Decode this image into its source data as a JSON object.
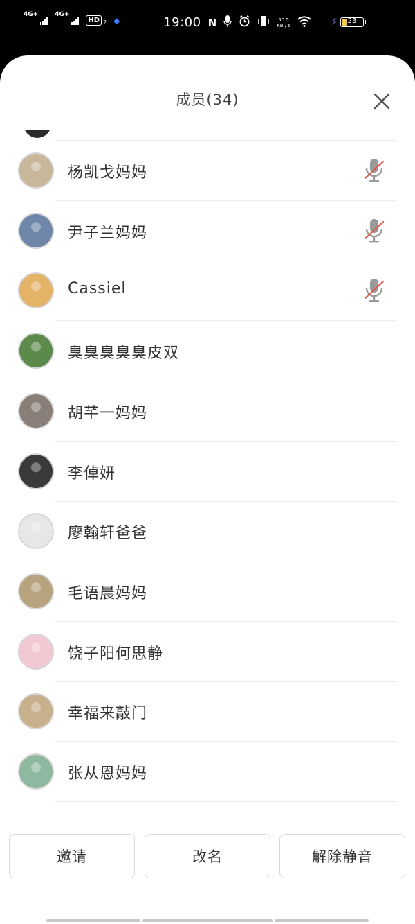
{
  "status_bar": {
    "time": "19:00",
    "signal1_label": "4G+",
    "signal2_label": "4G+",
    "hd_label": "HD",
    "hd_sub": "2",
    "net_speed_value": "50.5",
    "net_speed_unit": "KB / s",
    "battery_level": "23",
    "accent_battery": "#f2c94c",
    "accent_charging": "#a97cff",
    "icons": [
      "nfc-icon",
      "microphone-icon",
      "alarm-icon",
      "vibrate-icon",
      "wifi-icon",
      "charging-icon",
      "battery-icon"
    ]
  },
  "sheet": {
    "title": "成员(34)",
    "close_icon": "close-icon"
  },
  "members": [
    {
      "name": "杨凯戈妈妈",
      "muted": true,
      "avatar_color": "#c9b79c"
    },
    {
      "name": "尹子兰妈妈",
      "muted": true,
      "avatar_color": "#6e86a8"
    },
    {
      "name": "Cassiel",
      "muted": true,
      "avatar_color": "#e3b368"
    },
    {
      "name": "臭臭臭臭臭皮双",
      "muted": false,
      "avatar_color": "#5b8a4a"
    },
    {
      "name": "胡芊一妈妈",
      "muted": false,
      "avatar_color": "#8a7f78"
    },
    {
      "name": "李倬妍",
      "muted": false,
      "avatar_color": "#3a3a3a"
    },
    {
      "name": "廖翰轩爸爸",
      "muted": false,
      "avatar_color": "#e7e7e7"
    },
    {
      "name": "毛语晨妈妈",
      "muted": false,
      "avatar_color": "#b7a37e"
    },
    {
      "name": "饶子阳何思静",
      "muted": false,
      "avatar_color": "#f2c9d2"
    },
    {
      "name": "幸福来敲门",
      "muted": false,
      "avatar_color": "#c7b08c"
    },
    {
      "name": "张从恩妈妈",
      "muted": false,
      "avatar_color": "#8fb8a0"
    }
  ],
  "buttons": {
    "invite": "邀请",
    "rename": "改名",
    "unmute": "解除静音"
  },
  "colors": {
    "mute_slash": "#e05a4a",
    "mic_gray": "#9a9a9a",
    "divider": "#ececec"
  }
}
